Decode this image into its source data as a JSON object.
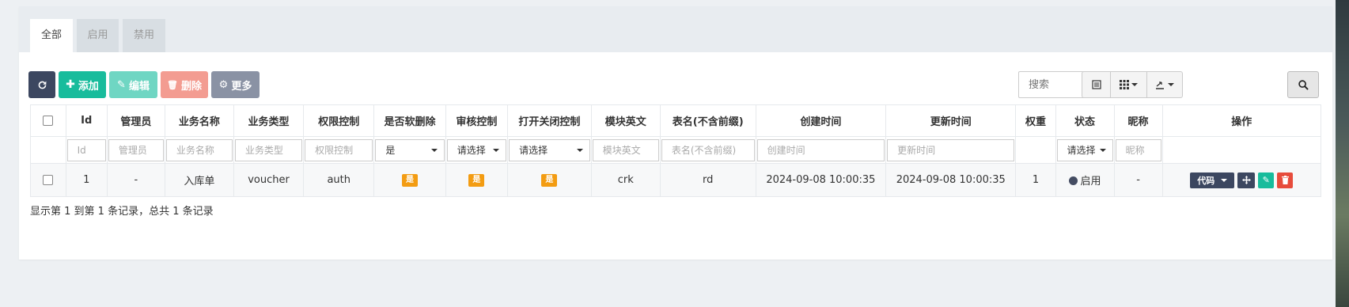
{
  "tabs": [
    {
      "label": "全部",
      "active": true
    },
    {
      "label": "启用",
      "active": false
    },
    {
      "label": "禁用",
      "active": false
    }
  ],
  "toolbar": {
    "refresh_icon": "refresh-icon",
    "add_label": "添加",
    "edit_label": "编辑",
    "delete_label": "删除",
    "more_label": "更多",
    "colors": {
      "refresh": "#3c4760",
      "add": "#18bc9c",
      "edit": "#6fd6c3",
      "delete": "#f39c91",
      "more": "#8a92a4"
    }
  },
  "search": {
    "placeholder": "搜索"
  },
  "table": {
    "headers": [
      "Id",
      "管理员",
      "业务名称",
      "业务类型",
      "权限控制",
      "是否软删除",
      "审核控制",
      "打开关闭控制",
      "模块英文",
      "表名(不含前缀)",
      "创建时间",
      "更新时间",
      "权重",
      "状态",
      "昵称",
      "操作"
    ],
    "filters": {
      "id": "Id",
      "admin": "管理员",
      "biz_name": "业务名称",
      "biz_type": "业务类型",
      "perm": "权限控制",
      "soft_delete": "是",
      "audit": "请选择",
      "toggle": "请选择",
      "module": "模块英文",
      "table_name": "表名(不含前缀)",
      "created": "创建时间",
      "updated": "更新时间",
      "status": "请选择",
      "nickname": "昵称"
    },
    "rows": [
      {
        "id": "1",
        "admin": "-",
        "biz_name": "入库单",
        "biz_type": "voucher",
        "perm": "auth",
        "soft_delete": "是",
        "audit": "是",
        "toggle": "是",
        "module": "crk",
        "table_name": "rd",
        "created": "2024-09-08 10:00:35",
        "updated": "2024-09-08 10:00:35",
        "weight": "1",
        "status": "启用",
        "nickname": "-",
        "ops": {
          "code_label": "代码"
        }
      }
    ]
  },
  "summary": "显示第 1 到第 1 条记录，总共 1 条记录"
}
